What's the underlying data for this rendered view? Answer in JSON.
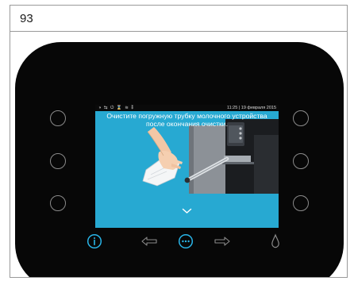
{
  "page": {
    "number": "93"
  },
  "screen": {
    "status": {
      "icons_text": "◑ ⇆ ⏻ ⌛ ≋ ⁑",
      "datetime": "11:25 | 19 февраля 2015"
    },
    "message": "Очистите погружную трубку молочного устройства после окончания очистки.",
    "illustration": "hand-wiping-milk-pipe-image",
    "scroll_icon": "chevron-down-icon"
  },
  "left_buttons": [
    "button-left-1",
    "button-left-2",
    "button-left-3"
  ],
  "right_buttons": [
    "button-right-1",
    "button-right-2",
    "button-right-3"
  ],
  "bottom_bar": {
    "icons": [
      "info-icon",
      "arrow-left-icon",
      "menu-dots-icon",
      "arrow-right-icon",
      "water-drop-icon"
    ]
  },
  "colors": {
    "screen_background": "#27a9d2",
    "device_body": "#070707",
    "accent_blue": "#29b5e8",
    "inactive_grey": "#8a8a8a"
  }
}
